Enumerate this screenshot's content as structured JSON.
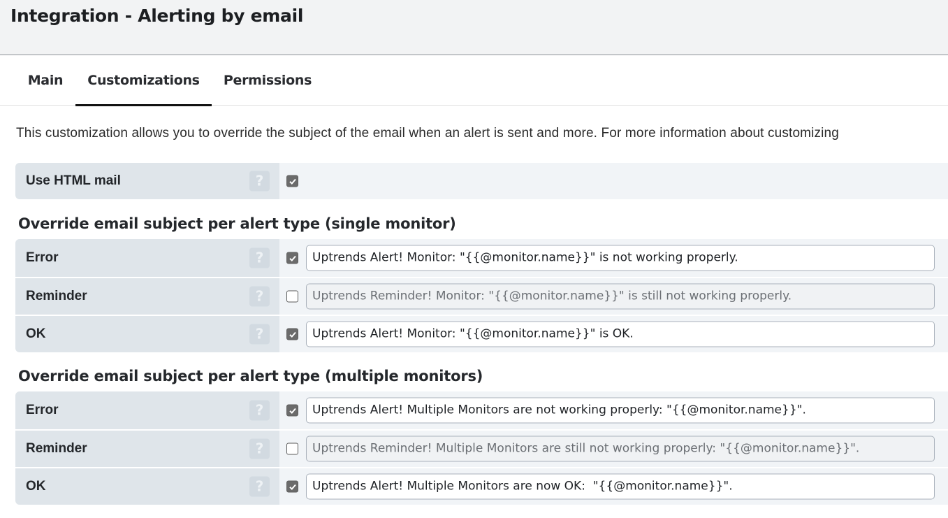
{
  "header": {
    "title": "Integration - Alerting by email"
  },
  "tabs": [
    {
      "label": "Main",
      "active": false
    },
    {
      "label": "Customizations",
      "active": true
    },
    {
      "label": "Permissions",
      "active": false
    }
  ],
  "intro": "This customization allows you to override the subject of the email when an alert is sent and more. For more information about customizing",
  "html_mail": {
    "label": "Use HTML mail",
    "help": "?",
    "checked": true
  },
  "single": {
    "title": "Override email subject per alert type (single monitor)",
    "rows": [
      {
        "label": "Error",
        "help": "?",
        "checked": true,
        "value": "Uptrends Alert! Monitor: \"{{@monitor.name}}\" is not working properly."
      },
      {
        "label": "Reminder",
        "help": "?",
        "checked": false,
        "value": "Uptrends Reminder! Monitor: \"{{@monitor.name}}\" is still not working properly."
      },
      {
        "label": "OK",
        "help": "?",
        "checked": true,
        "value": "Uptrends Alert! Monitor: \"{{@monitor.name}}\" is OK."
      }
    ]
  },
  "multiple": {
    "title": "Override email subject per alert type (multiple monitors)",
    "rows": [
      {
        "label": "Error",
        "help": "?",
        "checked": true,
        "value": "Uptrends Alert! Multiple Monitors are not working properly: \"{{@monitor.name}}\"."
      },
      {
        "label": "Reminder",
        "help": "?",
        "checked": false,
        "value": "Uptrends Reminder! Multiple Monitors are still not working properly: \"{{@monitor.name}}\"."
      },
      {
        "label": "OK",
        "help": "?",
        "checked": true,
        "value": "Uptrends Alert! Multiple Monitors are now OK:  \"{{@monitor.name}}\"."
      }
    ]
  }
}
